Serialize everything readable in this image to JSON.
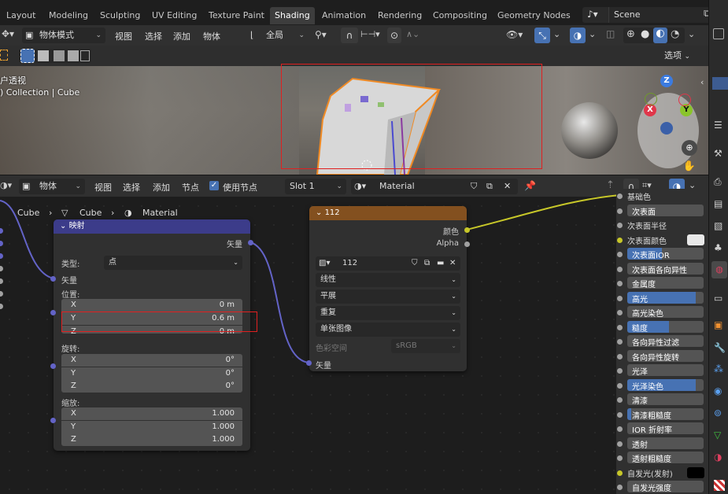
{
  "workspace_tabs": [
    "Layout",
    "Modeling",
    "Sculpting",
    "UV Editing",
    "Texture Paint",
    "Shading",
    "Animation",
    "Rendering",
    "Compositing",
    "Geometry Nodes"
  ],
  "active_tab": "Shading",
  "scene": {
    "name": "Scene"
  },
  "viewport_header": {
    "mode": "物体模式",
    "menus": [
      "视图",
      "选择",
      "添加",
      "物体"
    ],
    "transform": "全局"
  },
  "viewport_tool": {
    "options": "选项"
  },
  "viewport": {
    "view_label": "户透视",
    "collection_label": ") Collection | Cube",
    "gizmo": {
      "z": "Z",
      "x": "X",
      "y": "Y"
    }
  },
  "node_header": {
    "object": "物体",
    "menus": [
      "视图",
      "选择",
      "添加",
      "节点"
    ],
    "use_nodes": "使用节点",
    "slot": "Slot 1",
    "material": "Material"
  },
  "breadcrumb": [
    "Cube",
    "Cube",
    "Material"
  ],
  "mapping_node": {
    "title": "映射",
    "output": "矢量",
    "type_label": "类型:",
    "type_value": "点",
    "vector_input": "矢量",
    "location_label": "位置:",
    "location": [
      {
        "axis": "X",
        "value": "0 m"
      },
      {
        "axis": "Y",
        "value": "0.6 m"
      },
      {
        "axis": "Z",
        "value": "0 m"
      }
    ],
    "rotation_label": "旋转:",
    "rotation": [
      {
        "axis": "X",
        "value": "0°"
      },
      {
        "axis": "Y",
        "value": "0°"
      },
      {
        "axis": "Z",
        "value": "0°"
      }
    ],
    "scale_label": "缩放:",
    "scale": [
      {
        "axis": "X",
        "value": "1.000"
      },
      {
        "axis": "Y",
        "value": "1.000"
      },
      {
        "axis": "Z",
        "value": "1.000"
      }
    ]
  },
  "image_node": {
    "title": "112",
    "out_color": "颜色",
    "out_alpha": "Alpha",
    "image_name": "112",
    "interpolation": "线性",
    "projection": "平展",
    "extension": "重复",
    "source": "单张图像",
    "colorspace_label": "色彩空间",
    "colorspace_value": "sRGB",
    "vector_input": "矢量"
  },
  "bsdf_inputs": [
    {
      "label": "基础色",
      "kind": "text"
    },
    {
      "label": "次表面",
      "kind": "bar",
      "fill": 0
    },
    {
      "label": "次表面半径",
      "kind": "text"
    },
    {
      "label": "次表面颜色",
      "kind": "color"
    },
    {
      "label": "次表面IOR",
      "kind": "bar",
      "fill": 0.45
    },
    {
      "label": "次表面各向异性",
      "kind": "bar",
      "fill": 0
    },
    {
      "label": "金属度",
      "kind": "bar",
      "fill": 0
    },
    {
      "label": "高光",
      "kind": "bar",
      "fill": 0.9
    },
    {
      "label": "高光染色",
      "kind": "bar",
      "fill": 0
    },
    {
      "label": "糙度",
      "kind": "bar",
      "fill": 0.55
    },
    {
      "label": "各向异性过滤",
      "kind": "bar",
      "fill": 0
    },
    {
      "label": "各向异性旋转",
      "kind": "bar",
      "fill": 0
    },
    {
      "label": "光泽",
      "kind": "bar",
      "fill": 0
    },
    {
      "label": "光泽染色",
      "kind": "bar",
      "fill": 0.9
    },
    {
      "label": "清漆",
      "kind": "bar",
      "fill": 0
    },
    {
      "label": "清漆粗糙度",
      "kind": "bar",
      "fill": 0.05
    },
    {
      "label": "IOR 折射率",
      "kind": "bar",
      "fill": 0
    },
    {
      "label": "透射",
      "kind": "bar",
      "fill": 0
    },
    {
      "label": "透射粗糙度",
      "kind": "bar",
      "fill": 0
    },
    {
      "label": "自发光(发射)",
      "kind": "color"
    },
    {
      "label": "自发光强度",
      "kind": "bar",
      "fill": 0
    }
  ],
  "colors": {
    "accent": "#4772b3",
    "node_mapping_header": "#3c3c8a",
    "node_image_header": "#83501f",
    "highlight_box": "#e02020"
  }
}
